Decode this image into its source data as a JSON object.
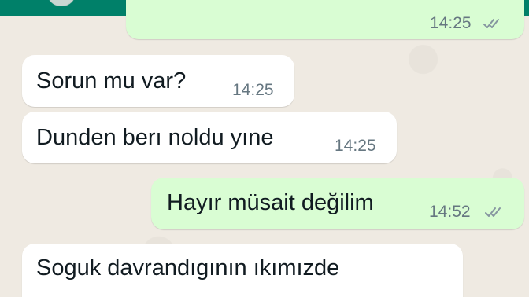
{
  "chat": {
    "messages": [
      {
        "direction": "outgoing",
        "text": "",
        "time": "14:25",
        "status": "read"
      },
      {
        "direction": "incoming",
        "text": "Sorun mu var?",
        "time": "14:25"
      },
      {
        "direction": "incoming",
        "text": "Dunden berı noldu yıne",
        "time": "14:25"
      },
      {
        "direction": "outgoing",
        "text": "Hayır müsait değilim",
        "time": "14:52",
        "status": "read"
      },
      {
        "direction": "incoming",
        "text": "Soguk davrandıgının ıkımızde",
        "time": ""
      }
    ]
  },
  "colors": {
    "header": "#008069",
    "wallpaper": "#efeae2",
    "incoming_bubble": "#ffffff",
    "outgoing_bubble": "#d9fdd3",
    "timestamp": "#667781",
    "read_ticks": "#8696a0"
  },
  "icons": {
    "read_receipt": "double-check-icon"
  }
}
